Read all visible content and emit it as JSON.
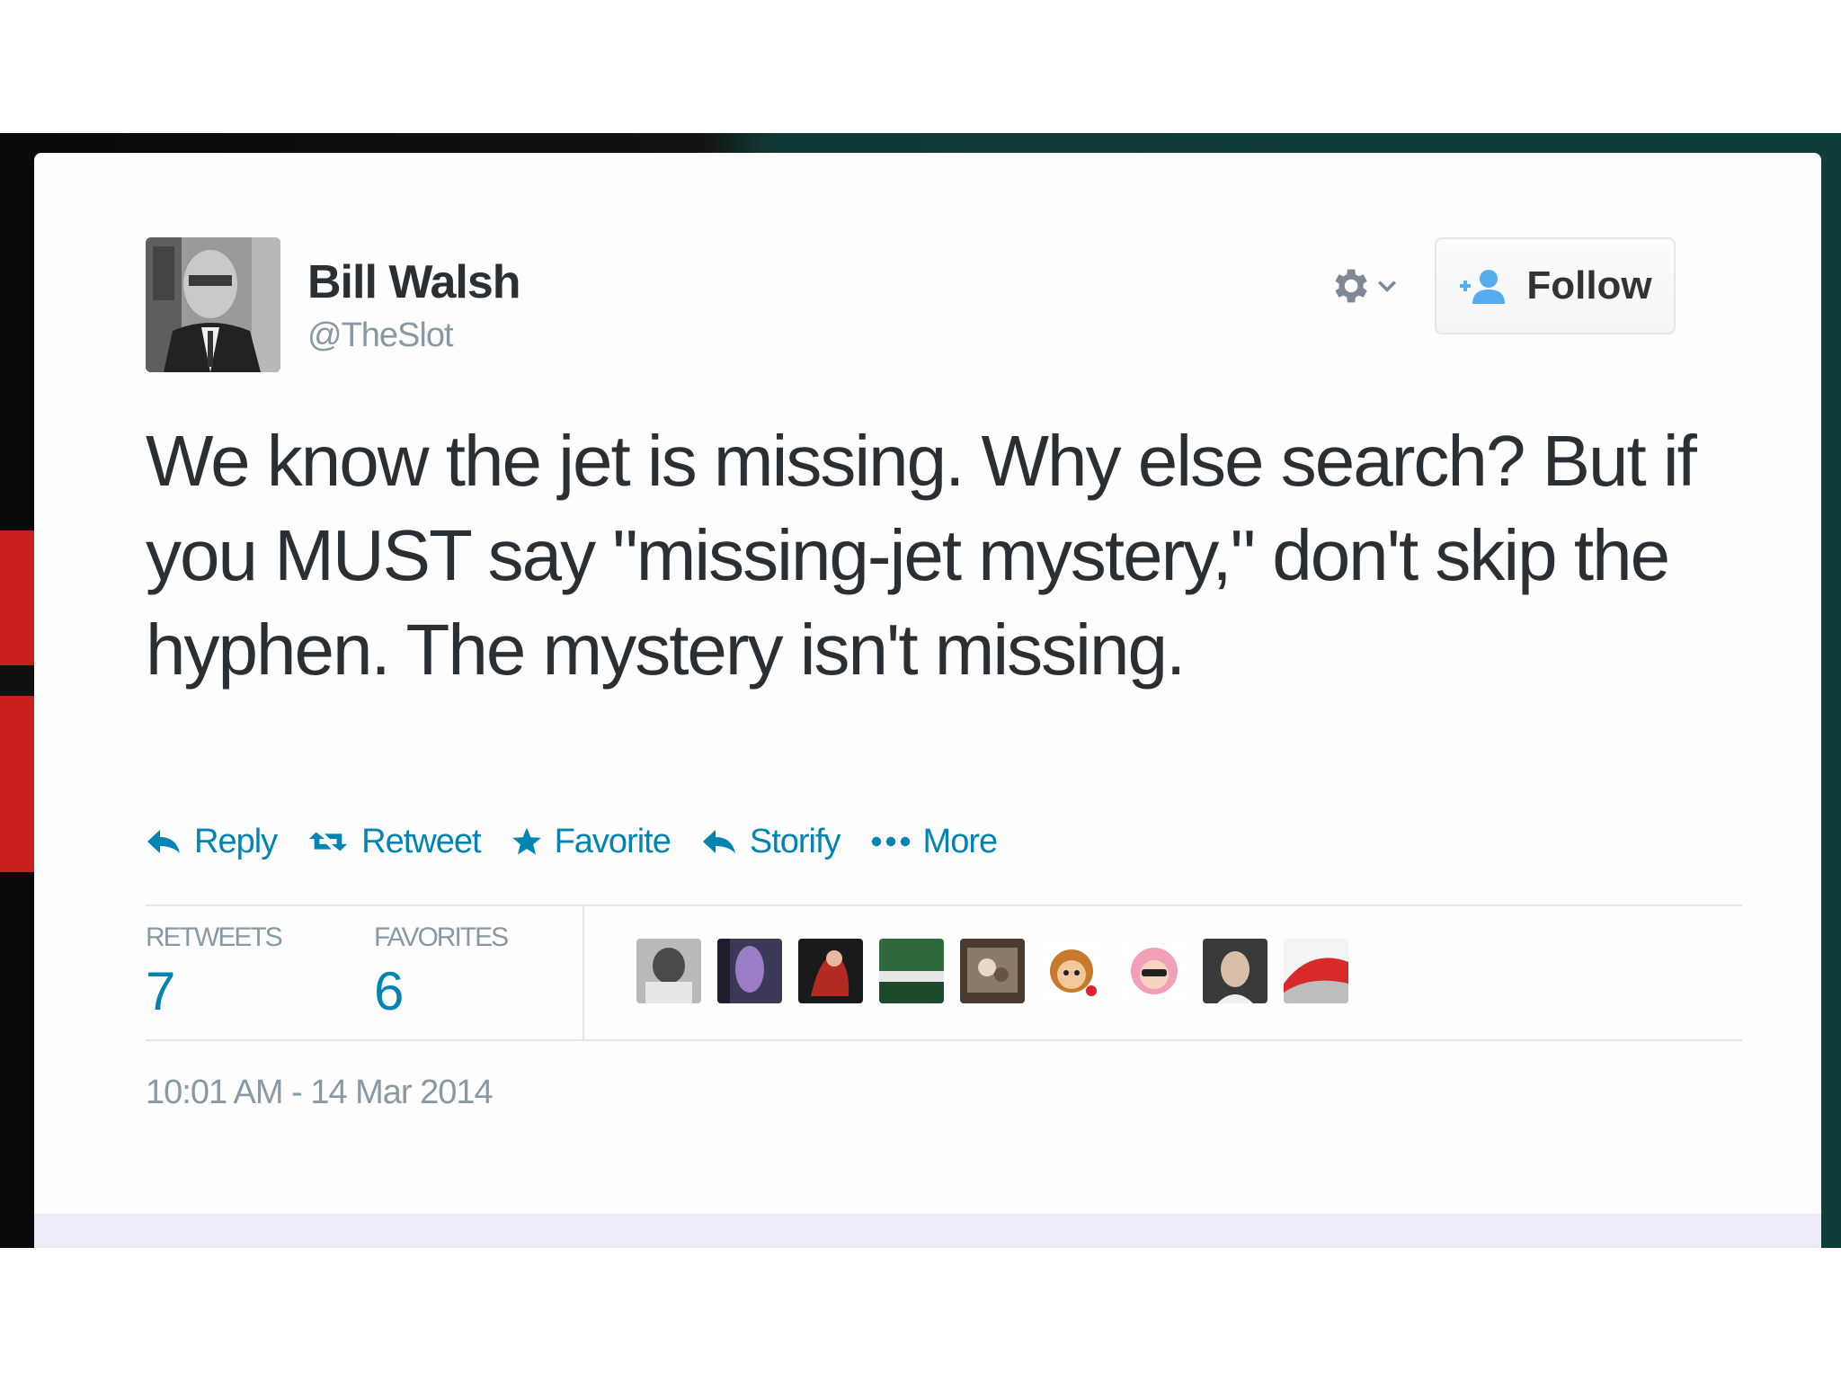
{
  "tweet": {
    "author": {
      "name": "Bill Walsh",
      "handle": "@TheSlot"
    },
    "text": "We know the jet is missing. Why else search? But if you MUST say \"missing-jet mystery,\" don't skip the hyphen. The mystery isn't missing.",
    "follow_label": "Follow",
    "actions": [
      {
        "label": "Reply",
        "icon": "reply-icon"
      },
      {
        "label": "Retweet",
        "icon": "retweet-icon"
      },
      {
        "label": "Favorite",
        "icon": "star-icon"
      },
      {
        "label": "Storify",
        "icon": "storify-icon"
      },
      {
        "label": "More",
        "icon": "more-dots-icon"
      }
    ],
    "stats": {
      "retweets_label": "RETWEETS",
      "retweets": "7",
      "favorites_label": "FAVORITES",
      "favorites": "6"
    },
    "timestamp": "10:01 AM - 14 Mar 2014"
  },
  "colors": {
    "link": "#0084b4",
    "text": "#292f33",
    "muted": "#8899a6",
    "border": "#e1e8ed"
  }
}
